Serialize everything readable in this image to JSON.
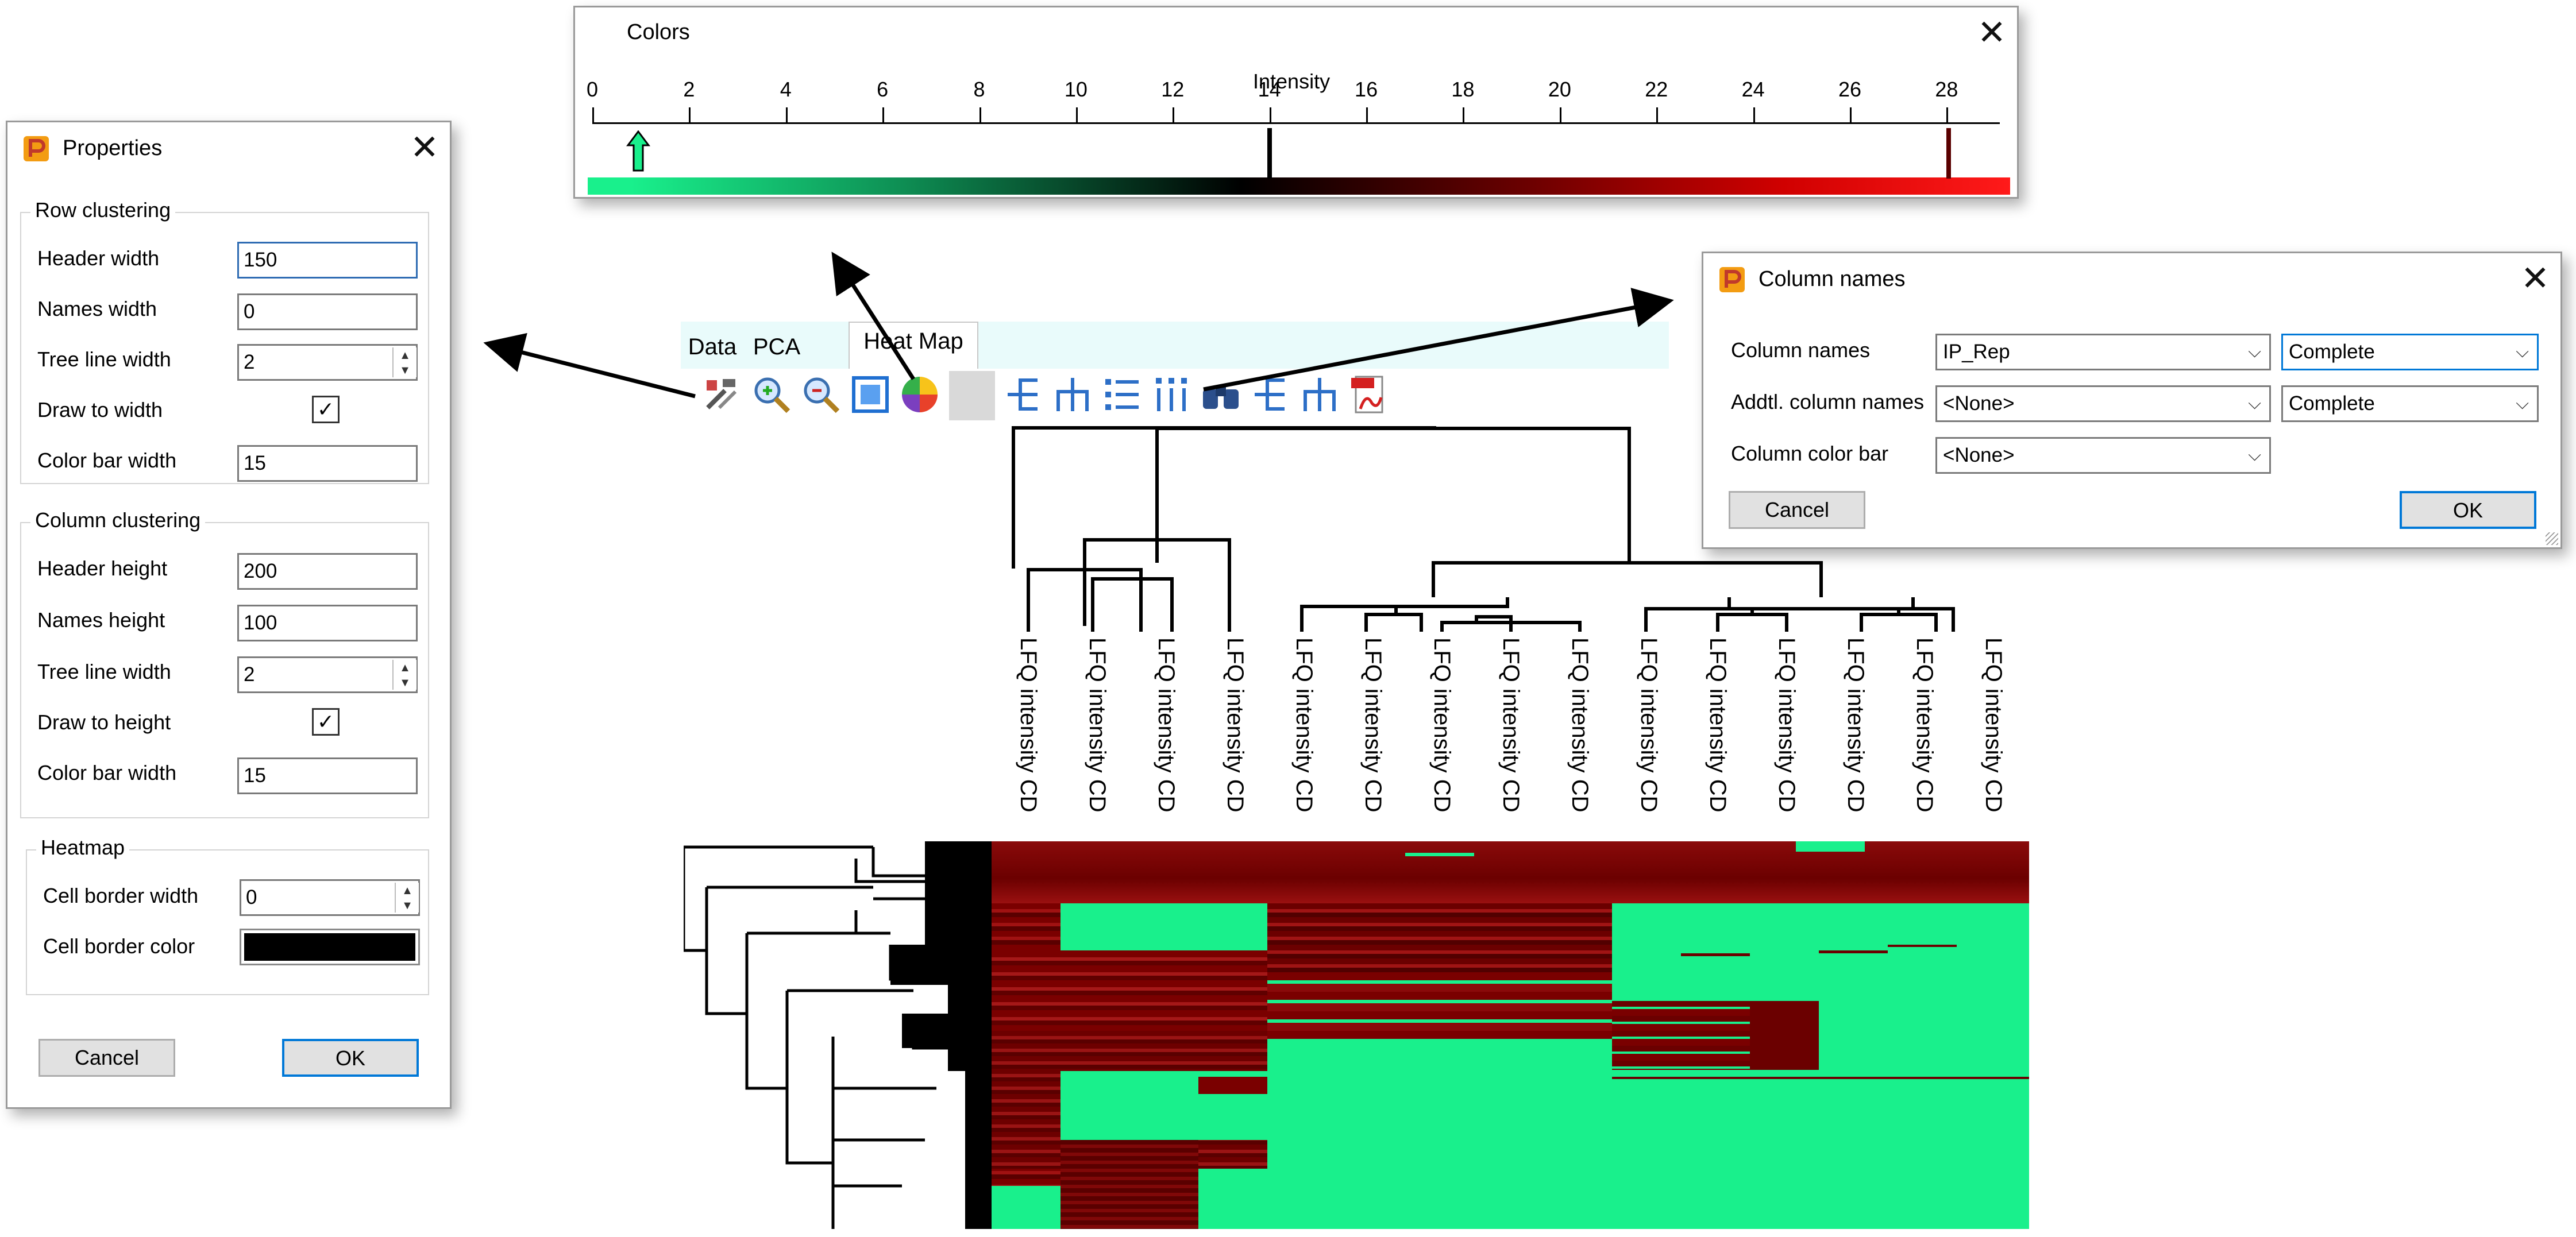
{
  "colors_dialog": {
    "title": "Colors",
    "axis_label": "Intensity",
    "ticks": [
      "0",
      "2",
      "4",
      "6",
      "8",
      "10",
      "12",
      "14",
      "16",
      "18",
      "20",
      "22",
      "24",
      "26",
      "28"
    ]
  },
  "properties_dialog": {
    "title": "Properties",
    "row_clustering": {
      "title": "Row clustering",
      "header_width_label": "Header width",
      "header_width_value": "150",
      "names_width_label": "Names width",
      "names_width_value": "0",
      "tree_line_width_label": "Tree line width",
      "tree_line_width_value": "2",
      "draw_to_width_label": "Draw to width",
      "draw_to_width_checked": "✓",
      "color_bar_width_label": "Color bar width",
      "color_bar_width_value": "15"
    },
    "column_clustering": {
      "title": "Column clustering",
      "header_height_label": "Header height",
      "header_height_value": "200",
      "names_height_label": "Names height",
      "names_height_value": "100",
      "tree_line_width_label": "Tree line width",
      "tree_line_width_value": "2",
      "draw_to_height_label": "Draw to height",
      "draw_to_height_checked": "✓",
      "color_bar_width_label": "Color bar width",
      "color_bar_width_value": "15"
    },
    "heatmap": {
      "title": "Heatmap",
      "cell_border_width_label": "Cell border width",
      "cell_border_width_value": "0",
      "cell_border_color_label": "Cell border color",
      "cell_border_color": "#000000"
    },
    "cancel_label": "Cancel",
    "ok_label": "OK"
  },
  "column_names_dialog": {
    "title": "Column names",
    "column_names_label": "Column names",
    "column_names_value": "IP_Rep",
    "column_names_mode": "Complete",
    "addtl_label": "Addtl. column names",
    "addtl_value": "<None>",
    "addtl_mode": "Complete",
    "color_bar_label": "Column color bar",
    "color_bar_value": "<None>",
    "cancel_label": "Cancel",
    "ok_label": "OK"
  },
  "main": {
    "tabs": [
      {
        "label": "Data"
      },
      {
        "label": "PCA"
      },
      {
        "label": "Heat Map"
      }
    ],
    "column_labels": [
      "LFQ intensity CD",
      "LFQ intensity CD",
      "LFQ intensity CD",
      "LFQ intensity CD",
      "LFQ intensity CD",
      "LFQ intensity CD",
      "LFQ intensity CD",
      "LFQ intensity CD",
      "LFQ intensity CD",
      "LFQ intensity CD",
      "LFQ intensity CD",
      "LFQ intensity CD",
      "LFQ intensity CD",
      "LFQ intensity CD",
      "LFQ intensity CD"
    ]
  },
  "colors": {
    "green": "#19f08c",
    "dark_red": "#7a0000",
    "red": "#ff1a1a",
    "toolbar_blue": "#2d6fc7"
  }
}
